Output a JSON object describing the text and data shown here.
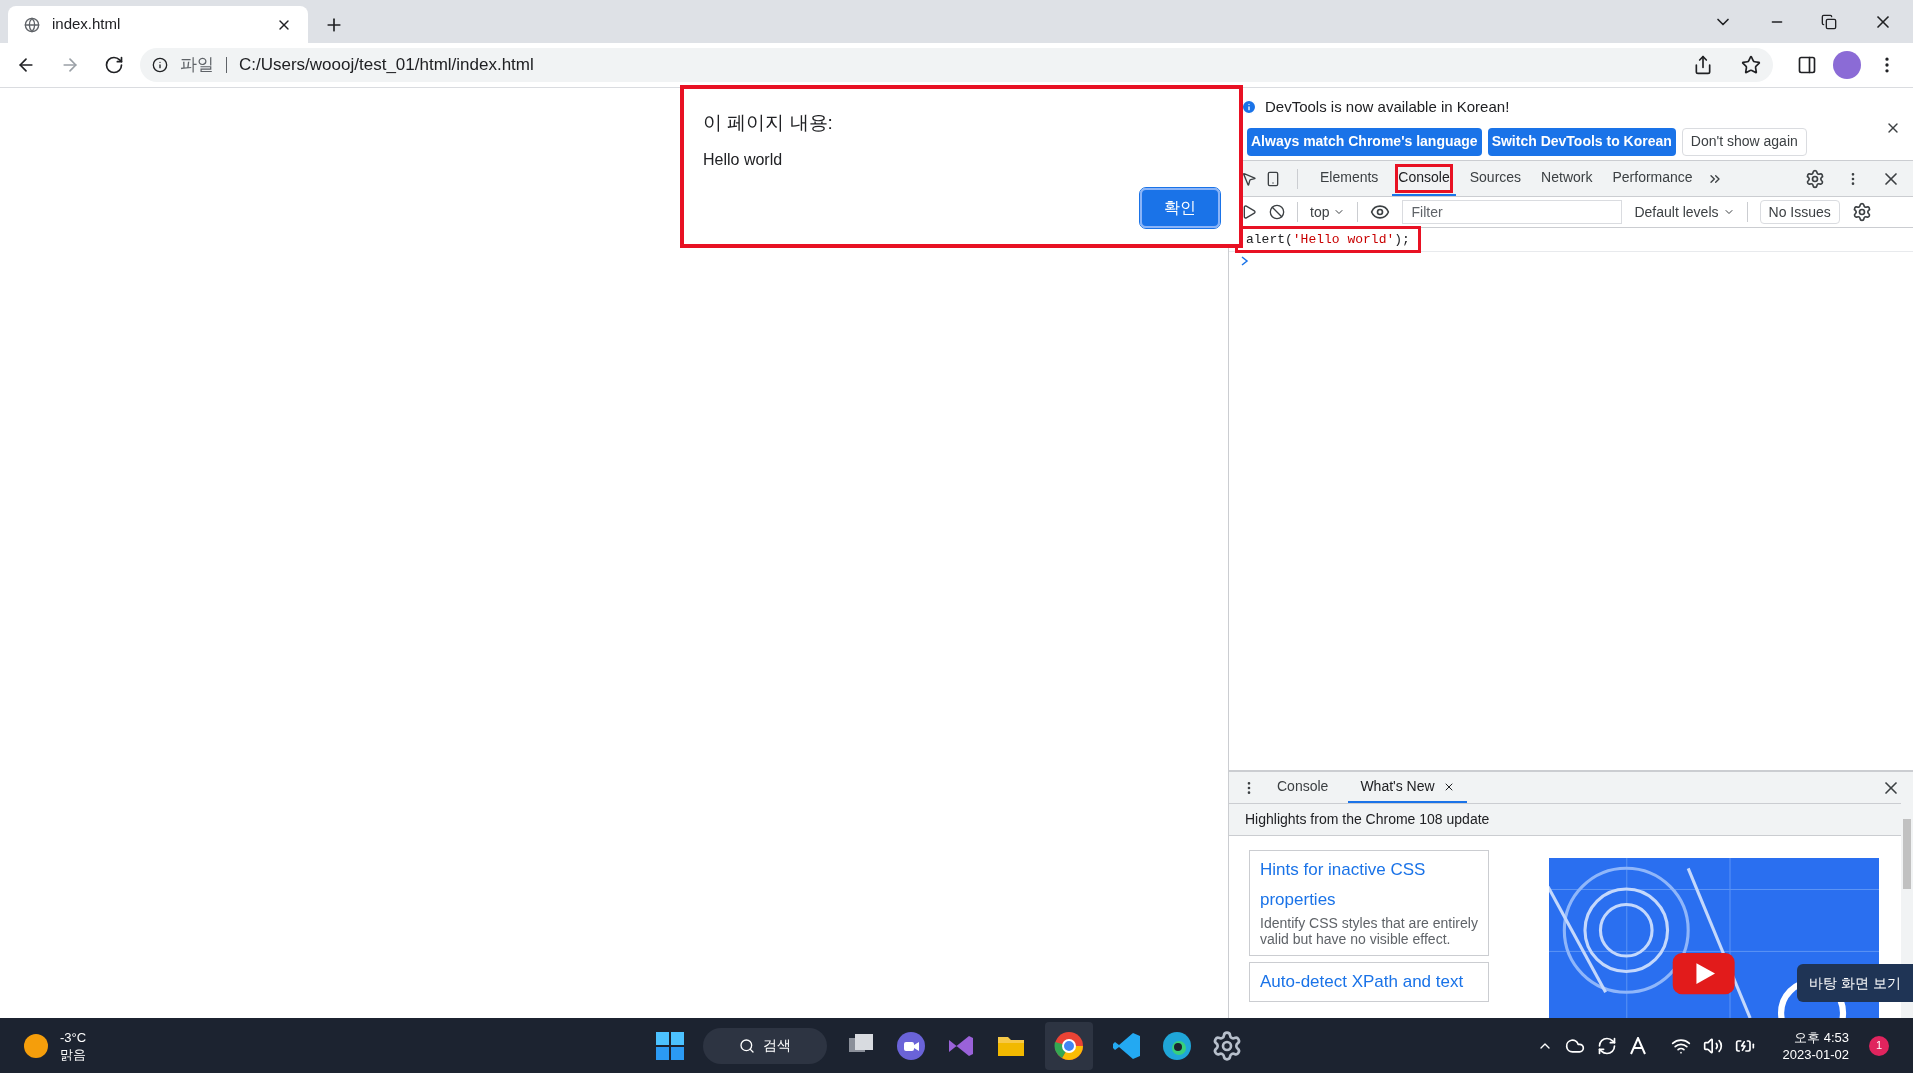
{
  "browser": {
    "tab_title": "index.html",
    "scheme_label": "파일",
    "url": "C:/Users/woooj/test_01/html/index.html"
  },
  "dialog": {
    "title": "이 페이지 내용:",
    "message": "Hello world",
    "button": "확인",
    "annotated": true
  },
  "devtools": {
    "info_message": "DevTools is now available in Korean!",
    "info_buttons": [
      {
        "label": "Always match Chrome's language",
        "kind": "primary"
      },
      {
        "label": "Switch DevTools to Korean",
        "kind": "primary"
      },
      {
        "label": "Don't show again",
        "kind": "secondary"
      }
    ],
    "tabs": [
      {
        "label": "Elements",
        "selected": false,
        "annotated": false
      },
      {
        "label": "Console",
        "selected": true,
        "annotated": true
      },
      {
        "label": "Sources",
        "selected": false,
        "annotated": false
      },
      {
        "label": "Network",
        "selected": false,
        "annotated": false
      },
      {
        "label": "Performance",
        "selected": false,
        "annotated": false
      }
    ],
    "context": "top",
    "filter_placeholder": "Filter",
    "levels": "Default levels",
    "issues": "No Issues",
    "console_lines": [
      {
        "code": "alert(",
        "string": "'Hello world'",
        "end": ");",
        "annotated": true
      }
    ],
    "drawer": {
      "tabs": [
        {
          "label": "Console",
          "selected": false,
          "closable": false
        },
        {
          "label": "What's New",
          "selected": true,
          "closable": true
        }
      ],
      "header": "Highlights from the Chrome 108 update",
      "cards": [
        {
          "title": "Hints for inactive CSS properties",
          "description": "Identify CSS styles that are entirely valid but have no visible effect."
        },
        {
          "title": "Auto-detect XPath and text"
        }
      ],
      "tooltip": "바탕 화면 보기"
    }
  },
  "taskbar": {
    "temperature": "-3°C",
    "condition": "맑음",
    "search": "검색",
    "time": "오후 4:53",
    "date": "2023-01-02",
    "notifications": "1"
  }
}
